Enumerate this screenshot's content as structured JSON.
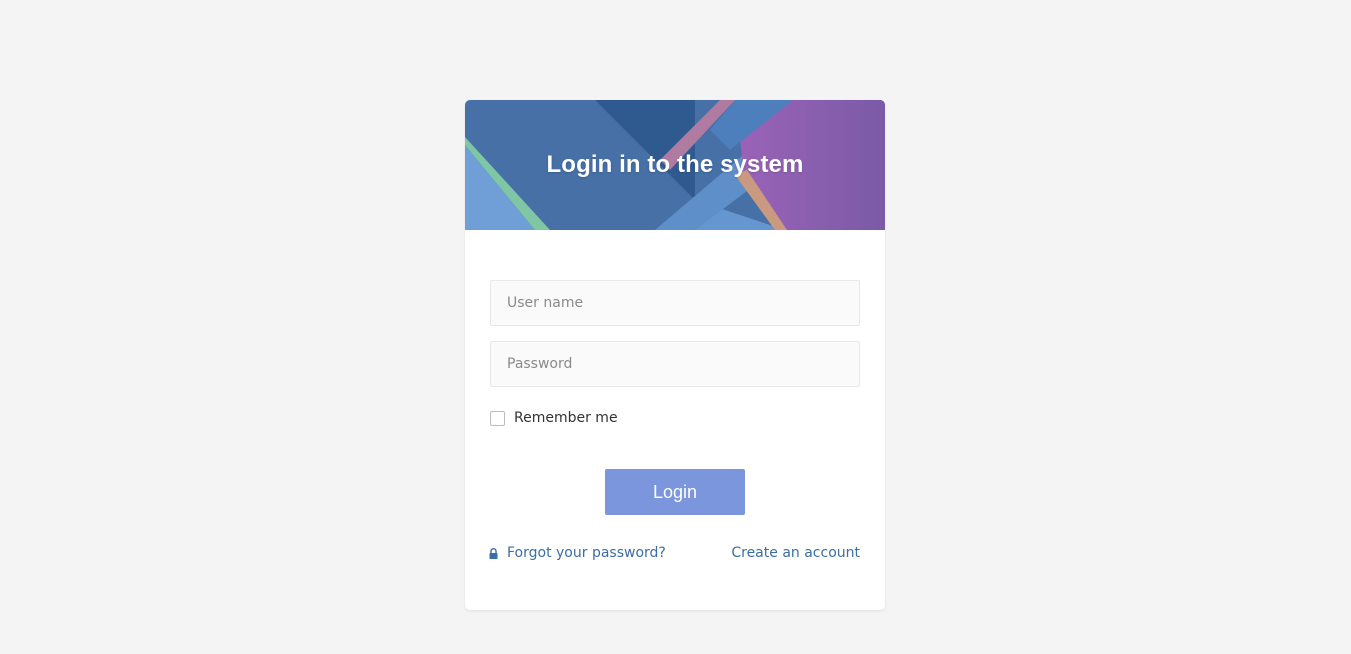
{
  "login": {
    "title": "Login in to the system",
    "username_placeholder": "User name",
    "username_value": "",
    "password_placeholder": "Password",
    "password_value": "",
    "remember_label": "Remember me",
    "remember_checked": false,
    "submit_label": "Login",
    "forgot_label": "Forgot your password?",
    "create_label": "Create an account"
  },
  "icons": {
    "forgot": "lock-icon"
  },
  "colors": {
    "page_background": "#f4f4f4",
    "button": "#7b96dc",
    "link": "#3b6ea5",
    "banner_blue": "#4a73a8",
    "banner_purple": "#8e5fb0"
  }
}
